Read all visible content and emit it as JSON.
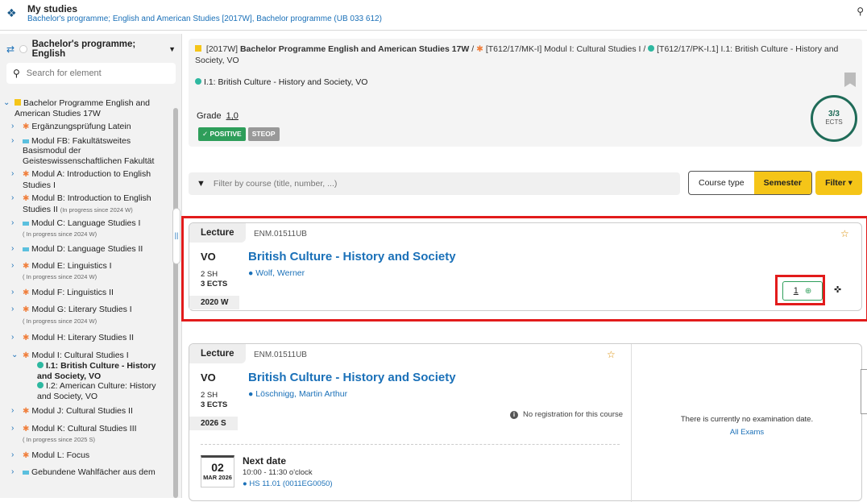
{
  "header": {
    "title": "My studies",
    "subtitle": "Bachelor's programme; English and American Studies [2017W], Bachelor programme (UB 033 612)"
  },
  "sidebar": {
    "selector_label": "Bachelor's programme; English",
    "search_placeholder": "Search for element",
    "items": [
      {
        "label": "Bachelor Programme English and American Studies 17W"
      },
      {
        "label": "Ergänzungsprüfung Latein"
      },
      {
        "label": "Modul FB: Fakultätsweites Basismodul der Geisteswissenschaftlichen Fakultät"
      },
      {
        "label": "Modul A: Introduction to English Studies I"
      },
      {
        "label": "Modul B: Introduction to English Studies II",
        "note": "(In progress since 2024 W)"
      },
      {
        "label": "Modul C: Language Studies I",
        "note": "( In progress since 2024 W)"
      },
      {
        "label": "Modul D: Language Studies II"
      },
      {
        "label": "Modul E: Linguistics I",
        "note": "( In progress since 2024 W)"
      },
      {
        "label": "Modul F: Linguistics II"
      },
      {
        "label": "Modul G: Literary Studies I",
        "note": "( In progress since 2024 W)"
      },
      {
        "label": "Modul H: Literary Studies II"
      },
      {
        "label": "Modul I: Cultural Studies I"
      },
      {
        "label": "I.1: British Culture - History and Society, VO"
      },
      {
        "label": "I.2: American Culture: History and Society, VO"
      },
      {
        "label": "Modul J: Cultural Studies II"
      },
      {
        "label": "Modul K: Cultural Studies III",
        "note": "( In progress since 2025 S)"
      },
      {
        "label": "Modul L: Focus"
      },
      {
        "label": "Gebundene Wahlfächer aus dem"
      }
    ]
  },
  "overview": {
    "crumb1_code": "[2017W]",
    "crumb1_name": "Bachelor Programme English and American Studies 17W",
    "crumb2_code": "[T612/17/MK-I]",
    "crumb2_name": "Modul I: Cultural Studies I",
    "crumb3_code": "[T612/17/PK-I.1]",
    "crumb3_name": "I.1: British Culture - History and Society, VO",
    "course": "I.1: British Culture - History and Society, VO",
    "grade_label": "Grade",
    "grade_value": "1,0",
    "badge_positive": "POSITIVE",
    "badge_steop": "STEOP",
    "ects_value": "3/3",
    "ects_label": "ECTS"
  },
  "filter": {
    "placeholder": "Filter by course (title, number, ...)",
    "course_type": "Course type",
    "semester": "Semester",
    "filter": "Filter"
  },
  "courses": [
    {
      "type": "Lecture",
      "code": "ENM.01511UB",
      "kind": "VO",
      "title": "British Culture - History and Society",
      "lecturer": "Wolf, Werner",
      "sh": "2 SH",
      "ects": "3 ECTS",
      "semester": "2020 W",
      "grade": "1"
    },
    {
      "type": "Lecture",
      "code": "ENM.01511UB",
      "kind": "VO",
      "title": "British Culture - History and Society",
      "lecturer": "Löschnigg, Martin Arthur",
      "sh": "2 SH",
      "ects": "3 ECTS",
      "semester": "2026 S",
      "registration": "No registration for this course",
      "exam_text": "There is currently no examination date.",
      "all_exams": "All Exams",
      "next_label": "Next date",
      "next_day": "02",
      "next_month": "MAR 2026",
      "next_time": "10:00 - 11:30 o'clock",
      "next_room": "HS 11.01 (0011EG0050)"
    }
  ],
  "colors": {
    "accent": "#f5c518",
    "link": "#1a70b8",
    "highlight": "#e21b1b",
    "positive": "#2e9e5a"
  }
}
